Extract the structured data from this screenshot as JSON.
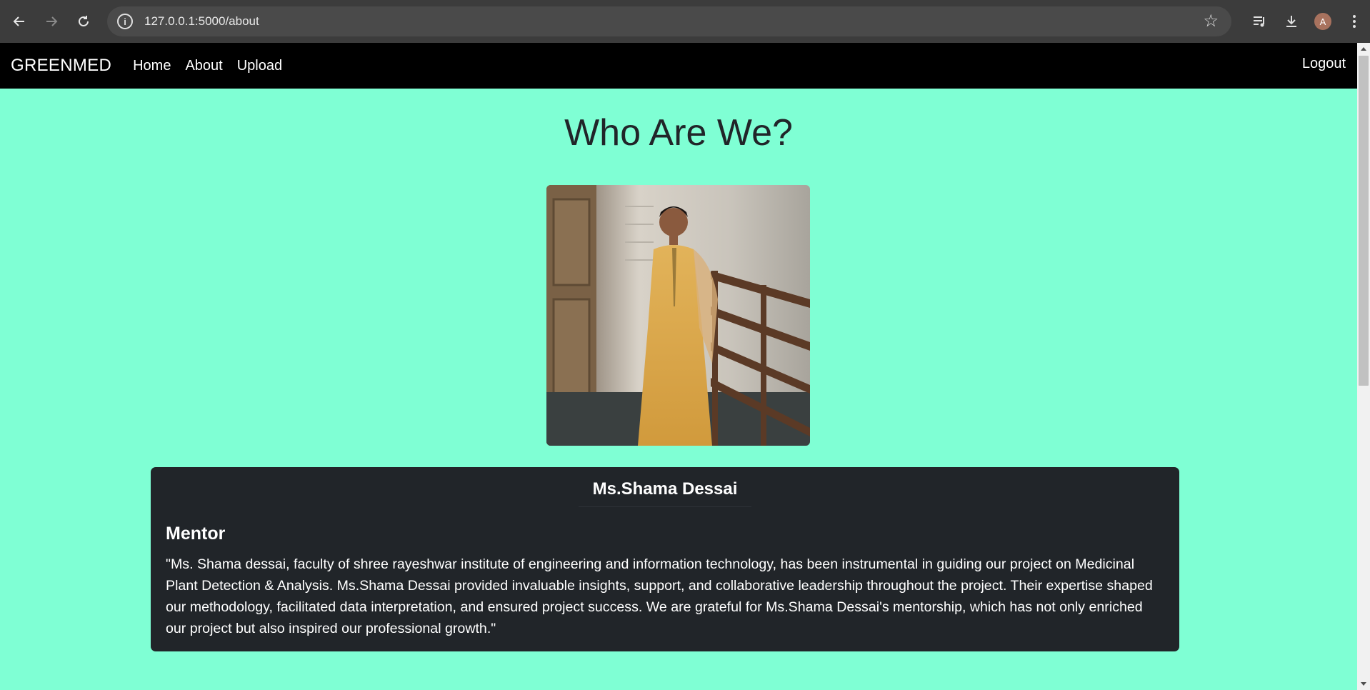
{
  "browser": {
    "url": "127.0.0.1:5000/about",
    "profile_initial": "A",
    "icons": [
      "back-icon",
      "forward-icon",
      "reload-icon",
      "site-info-icon",
      "bookmark-star-icon",
      "media-controls-icon",
      "download-icon",
      "menu-icon"
    ]
  },
  "navbar": {
    "brand": "GREENMED",
    "links": [
      "Home",
      "About",
      "Upload"
    ],
    "logout": "Logout"
  },
  "main": {
    "title": "Who Are We?",
    "card": {
      "name": "Ms.Shama Dessai",
      "role": "Mentor",
      "description": "\"Ms. Shama dessai, faculty of shree rayeshwar institute of engineering and information technology, has been instrumental in guiding our project on Medicinal Plant Detection & Analysis. Ms.Shama Dessai provided invaluable insights, support, and collaborative leadership throughout the project. Their expertise shaped our methodology, facilitated data interpretation, and ensured project success. We are grateful for Ms.Shama Dessai's mentorship, which has not only enriched our project but also inspired our professional growth.\""
    }
  },
  "colors": {
    "page_background": "#7fffd4",
    "navbar_background": "#000000",
    "card_background": "#212529",
    "title_text": "#212529"
  }
}
